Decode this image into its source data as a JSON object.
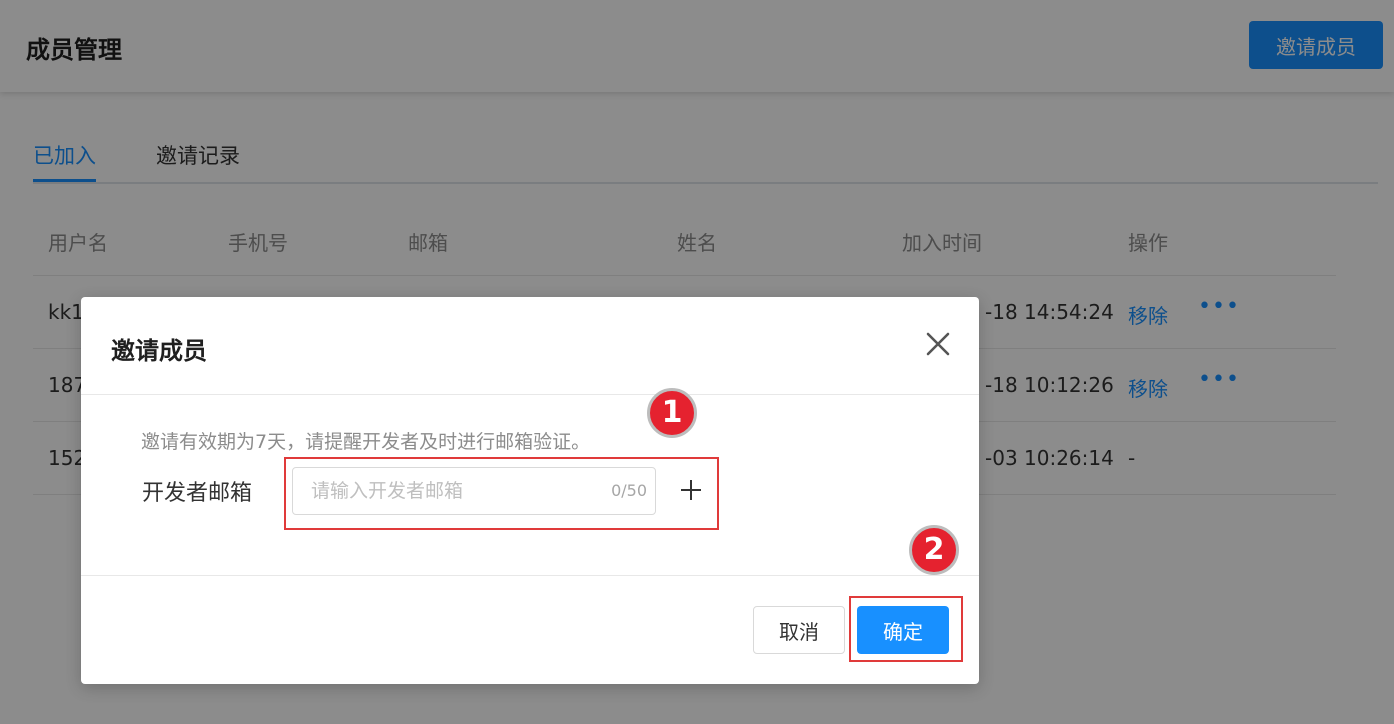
{
  "header": {
    "title": "成员管理",
    "invite_button": "邀请成员"
  },
  "tabs": [
    {
      "label": "已加入",
      "active": true
    },
    {
      "label": "邀请记录",
      "active": false
    }
  ],
  "table": {
    "columns": [
      "用户名",
      "手机号",
      "邮箱",
      "姓名",
      "加入时间",
      "操作"
    ],
    "rows": [
      {
        "username": "kk1",
        "join_time": "-18 14:54:24",
        "action": "移除",
        "has_more": true
      },
      {
        "username": "187",
        "join_time": "-18 10:12:26",
        "action": "移除",
        "has_more": true
      },
      {
        "username": "152",
        "join_time": "-03 10:26:14",
        "action": "-",
        "has_more": false
      }
    ]
  },
  "modal": {
    "title": "邀请成员",
    "hint": "邀请有效期为7天，请提醒开发者及时进行邮箱验证。",
    "field_label": "开发者邮箱",
    "email_placeholder": "请输入开发者邮箱",
    "email_value": "",
    "counter": "0/50",
    "cancel_label": "取消",
    "ok_label": "确定"
  },
  "annotations": [
    {
      "number": "1"
    },
    {
      "number": "2"
    }
  ],
  "colors": {
    "primary": "#1890ff",
    "annotation_red": "#e5222f",
    "mask": "rgba(0,0,0,0.45)"
  }
}
